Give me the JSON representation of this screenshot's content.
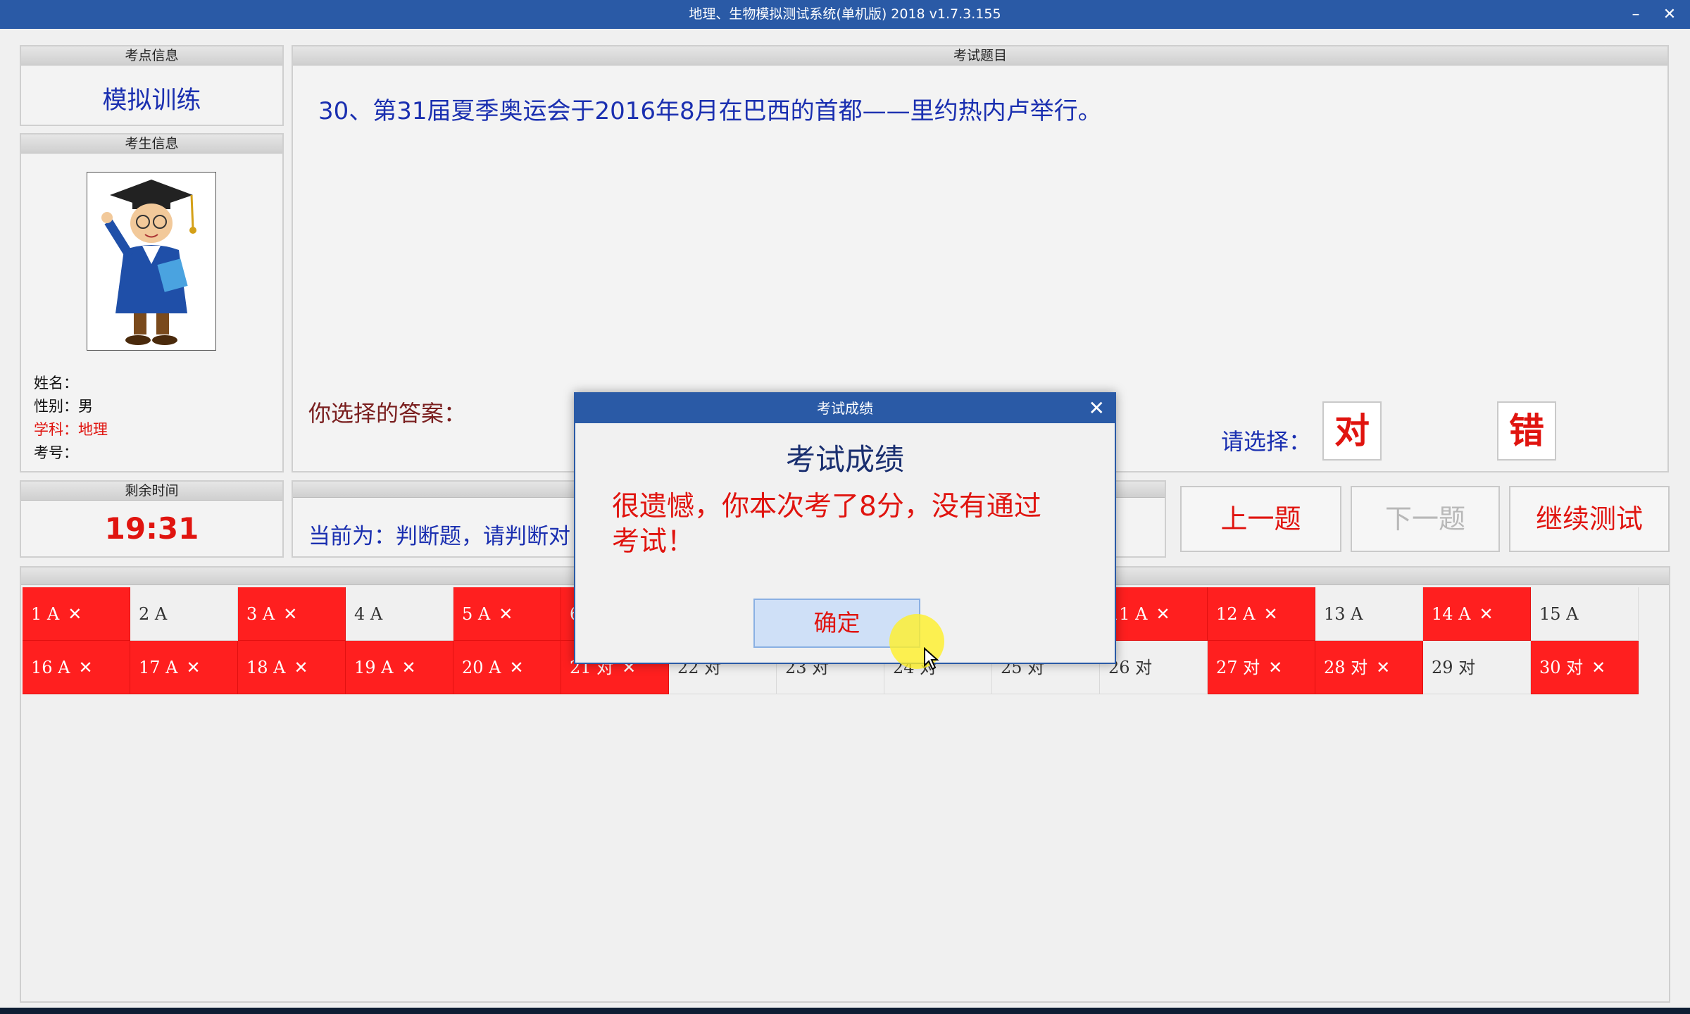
{
  "window": {
    "title": "地理、生物模拟测试系统(单机版) 2018 v1.7.3.155",
    "minimize_label": "–",
    "close_label": "✕"
  },
  "exam_point": {
    "header": "考点信息",
    "value": "模拟训练"
  },
  "candidate": {
    "header": "考生信息",
    "name_label": "姓名：",
    "gender_label": "性别：男",
    "subject_label": "学科：地理",
    "id_label": "考号："
  },
  "timer": {
    "header": "剩余时间",
    "value": "19:31"
  },
  "question": {
    "header": "考试题目",
    "text": "30、第31届夏季奥运会于2016年8月在巴西的首都——里约热内卢举行。",
    "your_answer_label": "你选择的答案：",
    "choose_label": "请选择：",
    "option_true": "对",
    "option_false": "错"
  },
  "status": {
    "text": "当前为：判断题，请判断对"
  },
  "nav": {
    "prev": "上一题",
    "next": "下一题",
    "continue": "继续测试"
  },
  "answers": {
    "row1": [
      {
        "label": "1 A",
        "mark": "✕",
        "wrong": true
      },
      {
        "label": "2 A",
        "mark": "",
        "wrong": false
      },
      {
        "label": "3 A",
        "mark": "✕",
        "wrong": true
      },
      {
        "label": "4 A",
        "mark": "",
        "wrong": false
      },
      {
        "label": "5 A",
        "mark": "✕",
        "wrong": true
      },
      {
        "label": "6",
        "mark": "",
        "wrong": true
      },
      {
        "label": "",
        "mark": "",
        "wrong": false
      },
      {
        "label": "",
        "mark": "",
        "wrong": false
      },
      {
        "label": "",
        "mark": "",
        "wrong": false
      },
      {
        "label": "",
        "mark": "",
        "wrong": false
      },
      {
        "label": "11 A",
        "mark": "✕",
        "wrong": true
      },
      {
        "label": "12 A",
        "mark": "✕",
        "wrong": true
      },
      {
        "label": "13 A",
        "mark": "",
        "wrong": false
      },
      {
        "label": "14 A",
        "mark": "✕",
        "wrong": true
      },
      {
        "label": "15 A",
        "mark": "",
        "wrong": false
      }
    ],
    "row2": [
      {
        "label": "16 A",
        "mark": "✕",
        "wrong": true
      },
      {
        "label": "17 A",
        "mark": "✕",
        "wrong": true
      },
      {
        "label": "18 A",
        "mark": "✕",
        "wrong": true
      },
      {
        "label": "19 A",
        "mark": "✕",
        "wrong": true
      },
      {
        "label": "20 A",
        "mark": "✕",
        "wrong": true
      },
      {
        "label": "21 对",
        "mark": "✕",
        "wrong": true
      },
      {
        "label": "22 对",
        "mark": "",
        "wrong": false
      },
      {
        "label": "23 对",
        "mark": "",
        "wrong": false
      },
      {
        "label": "24 对",
        "mark": "",
        "wrong": false
      },
      {
        "label": "25 对",
        "mark": "",
        "wrong": false
      },
      {
        "label": "26 对",
        "mark": "",
        "wrong": false
      },
      {
        "label": "27 对",
        "mark": "✕",
        "wrong": true
      },
      {
        "label": "28 对",
        "mark": "✕",
        "wrong": true
      },
      {
        "label": "29 对",
        "mark": "",
        "wrong": false
      },
      {
        "label": "30 对",
        "mark": "✕",
        "wrong": true
      }
    ]
  },
  "dialog": {
    "title": "考试成绩",
    "close": "✕",
    "heading": "考试成绩",
    "message": "很遗憾，你本次考了8分，没有通过考试！",
    "ok": "确定"
  },
  "colors": {
    "titlebar": "#2a5aa6",
    "wrong_cell": "#ff1f1f",
    "accent_red": "#e0140f",
    "question_blue": "#1a2fb0"
  }
}
